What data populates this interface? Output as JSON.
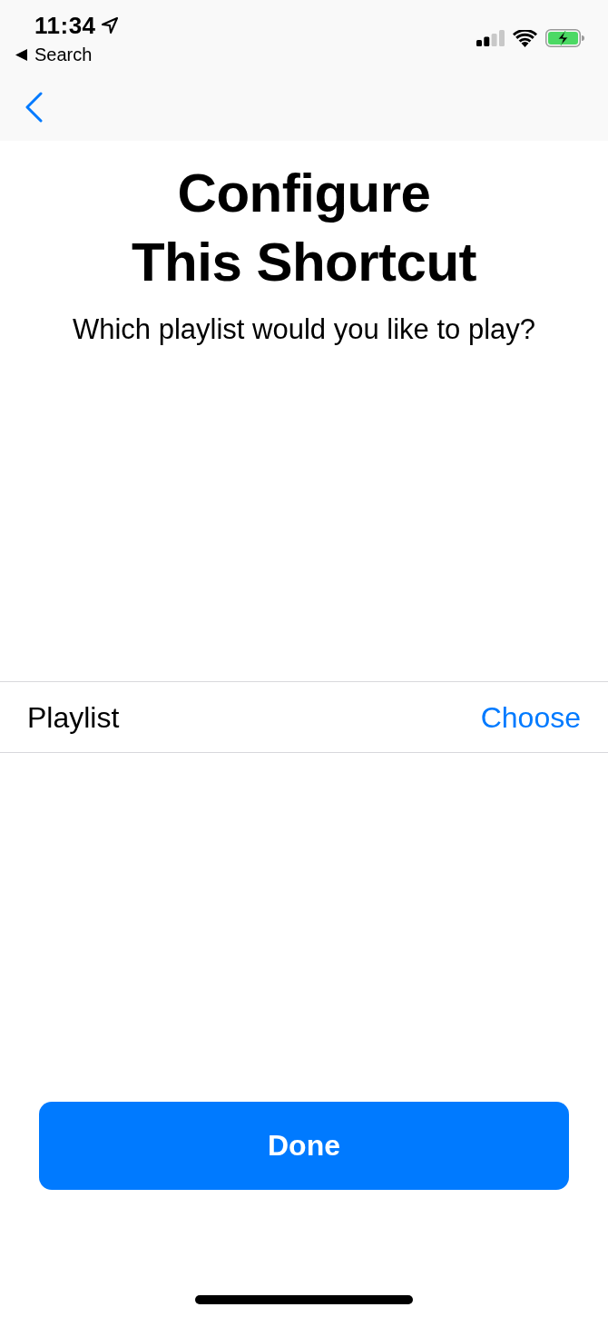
{
  "status_bar": {
    "time": "11:34",
    "back_label": "Search"
  },
  "header": {
    "title": "Configure This Shortcut",
    "subtitle": "Which playlist would you like to play?"
  },
  "parameters": [
    {
      "label": "Playlist",
      "value": "Choose"
    }
  ],
  "buttons": [
    {
      "label": "Done"
    }
  ]
}
